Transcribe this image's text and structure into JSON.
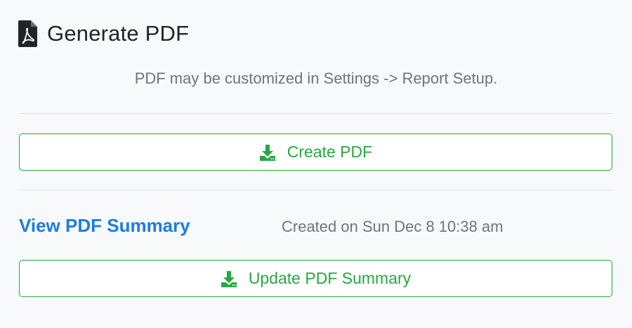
{
  "header": {
    "icon": "file-pdf-icon",
    "title": "Generate PDF"
  },
  "note": "PDF may be customized in Settings -> Report Setup.",
  "create_button": {
    "icon": "download-icon",
    "label": "Create PDF"
  },
  "summary": {
    "link_label": "View PDF Summary",
    "created_text": "Created on Sun Dec 8 10:38 am"
  },
  "update_button": {
    "icon": "download-icon",
    "label": "Update PDF Summary"
  },
  "colors": {
    "success": "#28a745",
    "link": "#1a7ee0",
    "muted": "#6c757d",
    "text": "#212529",
    "background": "#f8f9fa"
  }
}
